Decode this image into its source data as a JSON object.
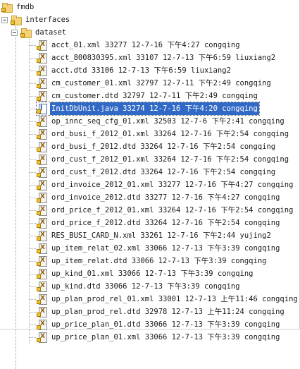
{
  "tree": {
    "nodes": [
      {
        "label": "fmdb",
        "type": "folder",
        "level": 0
      },
      {
        "label": "interfaces",
        "type": "folder",
        "level": 0,
        "expanded": true
      },
      {
        "label": "dataset",
        "type": "folder",
        "level": 1,
        "expanded": true
      },
      {
        "label": "acct_01.xml 33277  12-7-16 下午4:27  congqing",
        "type": "file",
        "level": 2
      },
      {
        "label": "acct_800830395.xml 33107  12-7-13 下午6:59  liuxiang2",
        "type": "file",
        "level": 2
      },
      {
        "label": "acct.dtd 33106  12-7-13 下午6:59  liuxiang2",
        "type": "file",
        "level": 2
      },
      {
        "label": "cm_customer_01.xml 32797  12-7-11 下午2:49  congqing",
        "type": "file",
        "level": 2
      },
      {
        "label": "cm_customer.dtd 32797  12-7-11 下午2:49  congqing",
        "type": "file",
        "level": 2
      },
      {
        "label": "InitDbUnit.java 33274  12-7-16 下午4:20  congqing",
        "type": "java",
        "level": 2,
        "selected": true
      },
      {
        "label": "op_innc_seq_cfg_01.xml 32503  12-7-6 下午2:41  congqing",
        "type": "file",
        "level": 2
      },
      {
        "label": "ord_busi_f_2012_01.xml 33264  12-7-16 下午2:54  congqing",
        "type": "file",
        "level": 2
      },
      {
        "label": "ord_busi_f_2012.dtd 33264  12-7-16 下午2:54  congqing",
        "type": "file",
        "level": 2
      },
      {
        "label": "ord_cust_f_2012_01.xml 33264  12-7-16 下午2:54  congqing",
        "type": "file",
        "level": 2
      },
      {
        "label": "ord_cust_f_2012.dtd 33264  12-7-16 下午2:54  congqing",
        "type": "file",
        "level": 2
      },
      {
        "label": "ord_invoice_2012_01.xml 33277  12-7-16 下午4:27  congqing",
        "type": "file",
        "level": 2
      },
      {
        "label": "ord_invoice_2012.dtd 33277  12-7-16 下午4:27  congqing",
        "type": "file",
        "level": 2
      },
      {
        "label": "ord_price_f_2012_01.xml 33264  12-7-16 下午2:54  congqing",
        "type": "file",
        "level": 2
      },
      {
        "label": "ord_price_f_2012.dtd 33264  12-7-16 下午2:54  congqing",
        "type": "file",
        "level": 2
      },
      {
        "label": "RES_BUSI_CARD_N.xml 33261  12-7-16 下午2:44  yujing2",
        "type": "file",
        "level": 2
      },
      {
        "label": "up_item_relat_02.xml 33066  12-7-13 下午3:39  congqing",
        "type": "file",
        "level": 2
      },
      {
        "label": "up_item_relat.dtd 33066  12-7-13 下午3:39  congqing",
        "type": "file",
        "level": 2
      },
      {
        "label": "up_kind_01.xml 33066  12-7-13 下午3:39  congqing",
        "type": "file",
        "level": 2
      },
      {
        "label": "up_kind.dtd 33066  12-7-13 下午3:39  congqing",
        "type": "file",
        "level": 2
      },
      {
        "label": "up_plan_prod_rel_01.xml 33001  12-7-13 上午11:46  congqing",
        "type": "file",
        "level": 2
      },
      {
        "label": "up_plan_prod_rel.dtd 32978  12-7-13 上午11:24  congqing",
        "type": "file",
        "level": 2
      },
      {
        "label": "up_price_plan_01.dtd 33066  12-7-13 下午3:39  congqing",
        "type": "file",
        "level": 2
      },
      {
        "label": "up_price_plan_01.xml 33066  12-7-13 下午3:39  congqing",
        "type": "file",
        "level": 2
      }
    ]
  }
}
